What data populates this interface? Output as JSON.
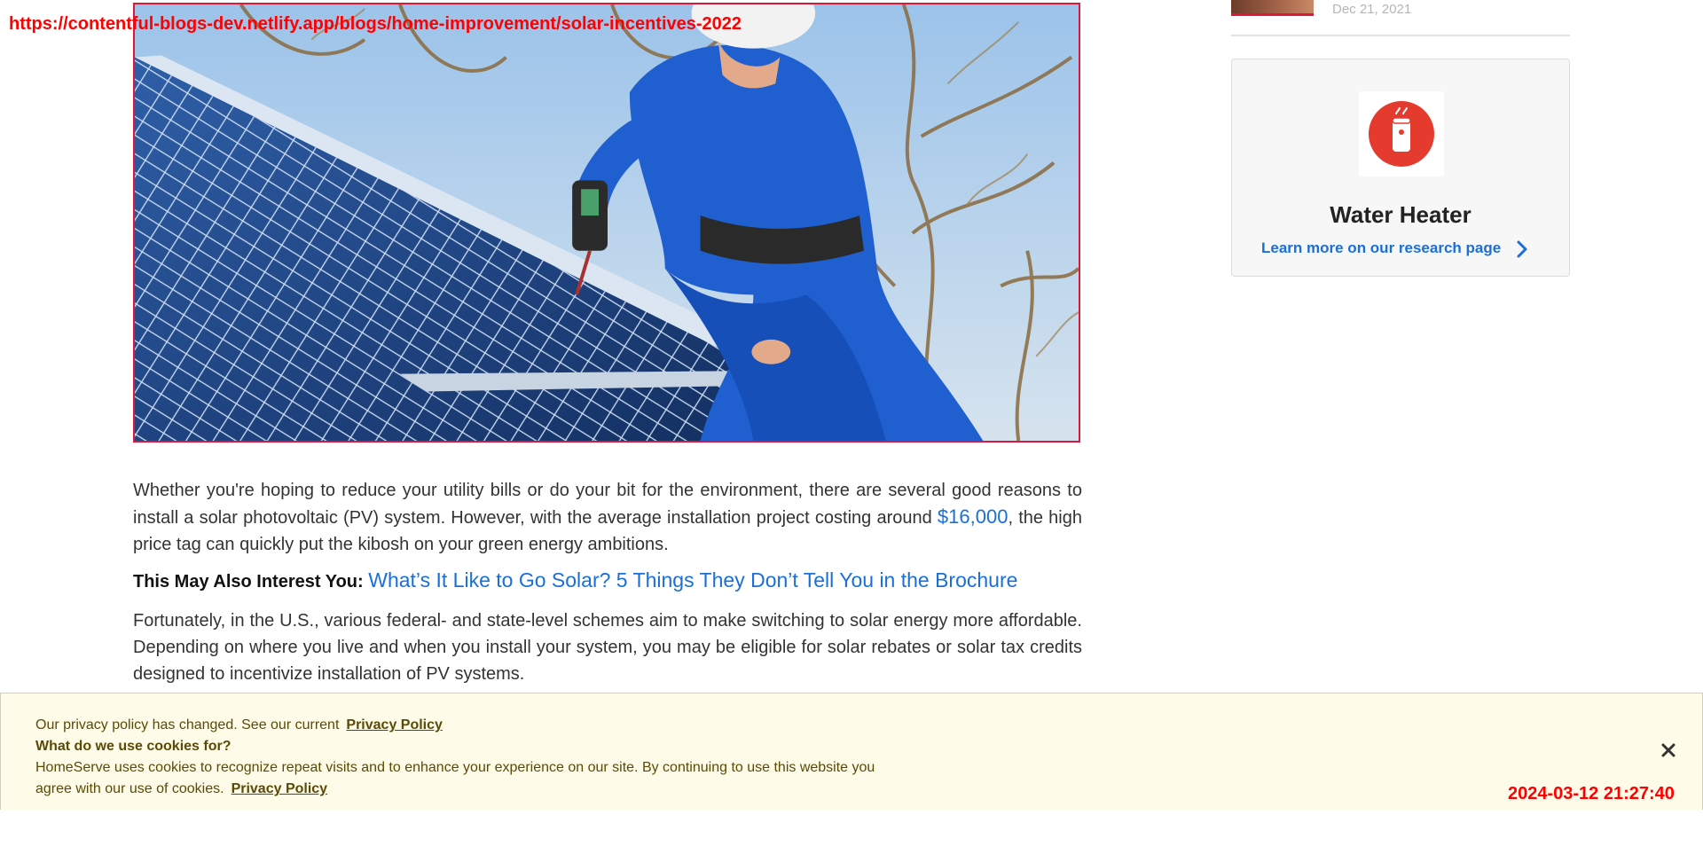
{
  "overlay": {
    "url": "https://contentful-blogs-dev.netlify.app/blogs/home-improvement/solar-incentives-2022",
    "timestamp": "2024-03-12 21:27:40"
  },
  "hero": {
    "icon": "hero-photo-solar-installer"
  },
  "article": {
    "p1_before": "Whether you're hoping to reduce your utility bills or do your bit for the environment, there are several good reasons to install a solar photovoltaic (PV) system. However, with the average installation project costing around ",
    "p1_link": "$16,000",
    "p1_after": ", the high price tag can quickly put the kibosh on your green energy ambitions.",
    "interest_label": "This May Also Interest You:",
    "interest_link": "What’s It Like to Go Solar? 5 Things They Don’t Tell You in the Brochure",
    "p2": "Fortunately, in the U.S., various federal- and state-level schemes aim to make switching to solar energy more affordable. Depending on where you live and when you install your system, you may be eligible for solar rebates or solar tax credits designed to incentivize installation of PV systems."
  },
  "sidebar": {
    "date": "Dec 21, 2021",
    "card": {
      "title": "Water Heater",
      "link": "Learn more on our research page",
      "icon": "water-heater-icon"
    }
  },
  "cookie": {
    "line1": "Our privacy policy has changed. See our current",
    "line1_link": "Privacy Policy",
    "heading": "What do we use cookies for?",
    "body": "HomeServe uses cookies to recognize repeat visits and to enhance your experience on our site. By continuing to use this website you agree with our use of cookies.",
    "body_link": "Privacy Policy"
  },
  "colors": {
    "link": "#1a6fd8",
    "accent_red": "#d9183b",
    "cookie_bg": "#fefce8",
    "cookie_text": "#5a4a06"
  }
}
